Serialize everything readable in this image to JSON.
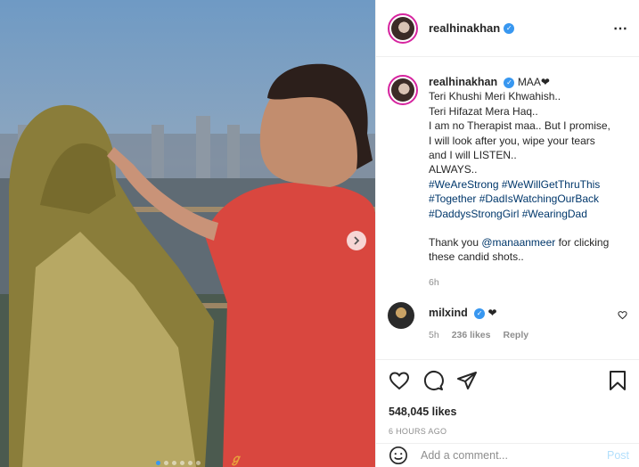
{
  "post": {
    "username": "realhinakhan",
    "verified": true,
    "more_icon": "⋯",
    "next_icon": "chevron-right-icon",
    "watermark": "ℊ"
  },
  "caption": {
    "username": "realhinakhan",
    "first_line": "MAA❤",
    "lines": [
      "Teri Khushi Meri Khwahish..",
      "Teri Hifazat Mera Haq..",
      "I am no Therapist maa.. But I promise,",
      "I will look after you, wipe your tears",
      "and I will LISTEN..",
      "ALWAYS.."
    ],
    "hashtags_line1": [
      "#WeAreStrong",
      "#WeWillGetThruThis"
    ],
    "hashtags_line2": [
      "#Together",
      "#DadIsWatchingOurBack"
    ],
    "hashtags_line3": [
      "#DaddysStrongGirl",
      "#WearingDad"
    ],
    "thanks_prefix": "Thank you ",
    "thanks_mention": "@manaanmeer",
    "thanks_suffix": " for clicking",
    "thanks_line2": "these candid shots..",
    "time": "6h"
  },
  "comment": {
    "username": "milxind",
    "text": "❤",
    "time": "5h",
    "likes": "236 likes",
    "reply": "Reply"
  },
  "actions": {
    "likes": "548,045 likes",
    "ago": "6 HOURS AGO"
  },
  "add_comment": {
    "placeholder": "Add a comment...",
    "post": "Post"
  },
  "colors": {
    "link": "#00376b",
    "verified": "#3897f0",
    "muted": "#8e8e8e"
  }
}
